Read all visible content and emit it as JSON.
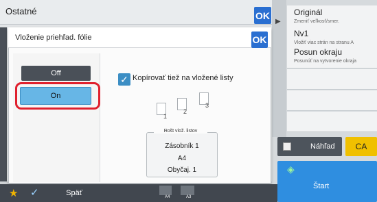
{
  "outer": {
    "title": "Ostatné",
    "ok_label": "OK"
  },
  "dialog": {
    "title": "Vloženie priehľad. fólie",
    "ok_label": "OK",
    "off_label": "Off",
    "on_label": "On",
    "checkbox_label": "Kopírovať tiež na vložené listy",
    "page_icons": [
      "1",
      "2",
      "3"
    ],
    "tray": {
      "title": "Rošt vlož. listov",
      "source": "Zásobník 1",
      "size": "A4",
      "type": "Obyčaj. 1"
    }
  },
  "right_menu": [
    {
      "title": "Originál",
      "subtitle": "Zmeniť veľkosť/smer."
    },
    {
      "title": "Nv1",
      "subtitle": "Vložiť viac strán na stranu A"
    },
    {
      "title": "Posun okraju",
      "subtitle": "Posunúť na vytvorenie okraja"
    }
  ],
  "buttons": {
    "preview": "Náhľad",
    "ca": "CA",
    "start": "Štart"
  },
  "bottom_bar": {
    "back": "Späť",
    "size_a4": "A4",
    "size_a3": "A3"
  },
  "colors": {
    "accent_blue": "#2a6fd1",
    "highlight_red": "#e0202e",
    "selected_on": "#67b6e6",
    "ca_yellow": "#f0c000"
  }
}
